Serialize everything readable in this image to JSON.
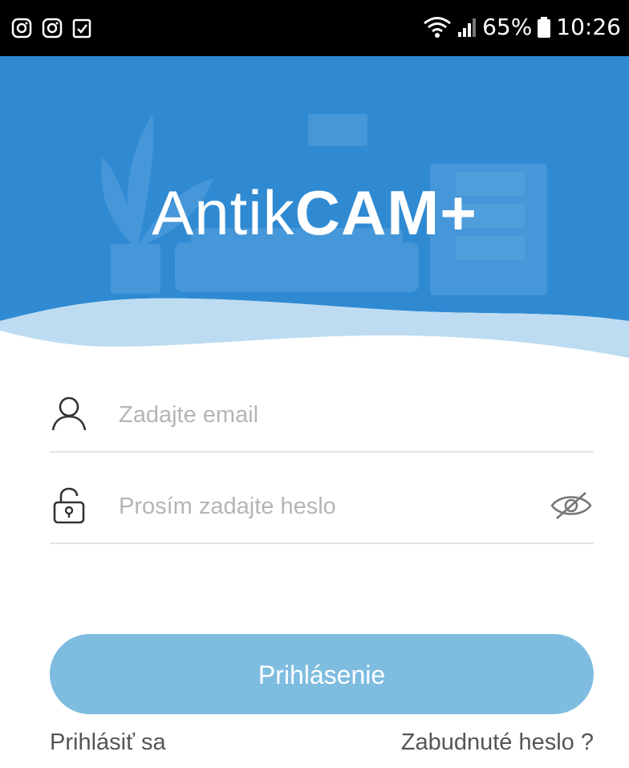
{
  "status_bar": {
    "left_icons": [
      "instagram-icon",
      "instagram-icon",
      "checklist-icon"
    ],
    "battery_percent": "65%",
    "time": "10:26"
  },
  "header": {
    "title_regular": "Antik",
    "title_bold": "CAM+",
    "background_color": "#2f8ad2"
  },
  "form": {
    "email": {
      "value": "",
      "placeholder": "Zadajte email"
    },
    "password": {
      "value": "",
      "placeholder": "Prosím zadajte heslo"
    },
    "login_button_label": "Prihlásenie",
    "signin_link": "Prihlásiť sa",
    "forgot_password_link": "Zabudnuté heslo ?"
  },
  "colors": {
    "accent": "#2f8ad2",
    "button": "#7fbde0"
  }
}
